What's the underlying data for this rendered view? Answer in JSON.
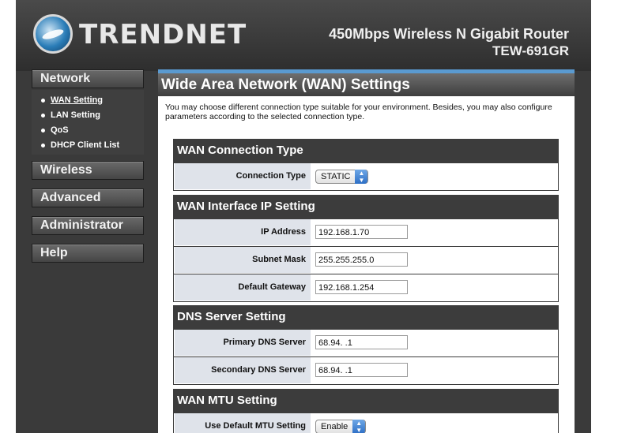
{
  "brand": {
    "logo_text": "TRENDNET",
    "product_title": "450Mbps Wireless N Gigabit Router",
    "product_model": "TEW-691GR"
  },
  "sidebar": {
    "sections": [
      {
        "label": "Network"
      },
      {
        "label": "Wireless"
      },
      {
        "label": "Advanced"
      },
      {
        "label": "Administrator"
      },
      {
        "label": "Help"
      }
    ],
    "network_items": [
      {
        "label": "WAN Setting",
        "active": true
      },
      {
        "label": "LAN Setting"
      },
      {
        "label": "QoS"
      },
      {
        "label": "DHCP Client List"
      }
    ]
  },
  "main": {
    "title": "Wide Area Network (WAN) Settings",
    "intro": "You may choose different connection type suitable for your environment. Besides, you may also configure parameters according to the selected connection type.",
    "sections": {
      "wan_connection_type": {
        "title": "WAN Connection Type",
        "connection_type_label": "Connection Type",
        "connection_type_value": "STATIC"
      },
      "wan_interface": {
        "title": "WAN Interface IP Setting",
        "ip_label": "IP Address",
        "ip_value": "192.168.1.70",
        "mask_label": "Subnet Mask",
        "mask_value": "255.255.255.0",
        "gateway_label": "Default Gateway",
        "gateway_value": "192.168.1.254"
      },
      "dns": {
        "title": "DNS Server Setting",
        "primary_label": "Primary DNS Server",
        "primary_value": "68.94.   .1",
        "secondary_label": "Secondary DNS Server",
        "secondary_value": "68.94.   .1"
      },
      "mtu": {
        "title": "WAN MTU Setting",
        "default_label": "Use Default MTU Setting",
        "default_value": "Enable"
      }
    }
  },
  "colors": {
    "frame": "#3a3a3a",
    "accent_blue": "#5a9ad0",
    "label_bg": "#dfe3ea"
  }
}
